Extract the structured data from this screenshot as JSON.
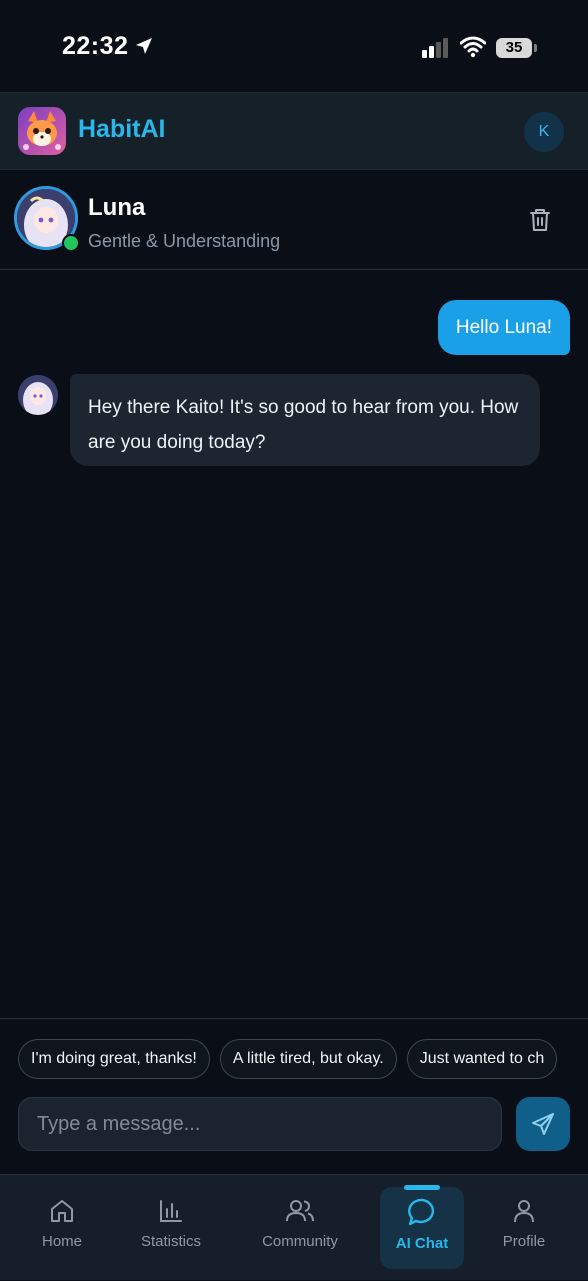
{
  "status_bar": {
    "time": "22:32",
    "battery": "35"
  },
  "header": {
    "app_name": "HabitAI",
    "avatar_initial": "K"
  },
  "chat": {
    "bot_name": "Luna",
    "bot_description": "Gentle & Understanding",
    "messages": [
      {
        "sender": "user",
        "text": "Hello Luna!"
      },
      {
        "sender": "bot",
        "text": "Hey there Kaito! It's so good to hear from you. How are you doing today?"
      }
    ]
  },
  "quick_replies": [
    "I'm doing great, thanks!",
    "A little tired, but okay.",
    "Just wanted to ch"
  ],
  "composer": {
    "placeholder": "Type a message..."
  },
  "nav": {
    "items": [
      {
        "label": "Home",
        "icon": "home-icon"
      },
      {
        "label": "Statistics",
        "icon": "bar-chart-icon"
      },
      {
        "label": "Community",
        "icon": "users-icon"
      },
      {
        "label": "AI Chat",
        "icon": "chat-bubble-icon",
        "active": true
      },
      {
        "label": "Profile",
        "icon": "user-icon"
      }
    ]
  },
  "colors": {
    "accent": "#29b6e8",
    "online": "#22c55e",
    "user_bubble": "#1aa0e6"
  }
}
